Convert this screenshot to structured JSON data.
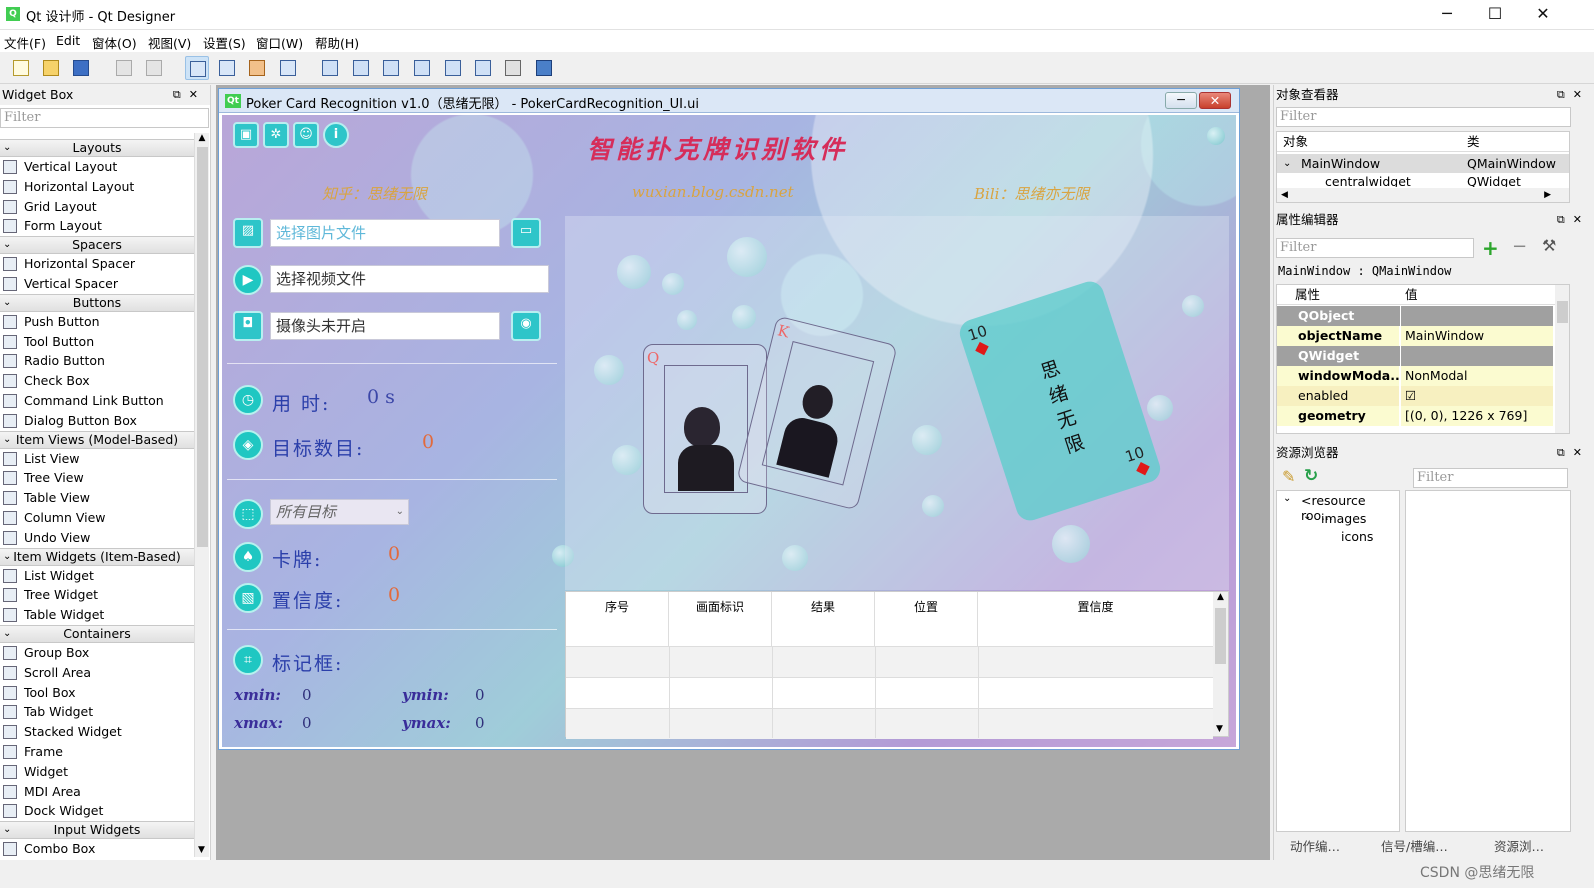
{
  "window": {
    "title": "Qt 设计师 - Qt Designer",
    "app_icon": "qt-icon"
  },
  "menu": [
    "文件(F)",
    "Edit",
    "窗体(O)",
    "视图(V)",
    "设置(S)",
    "窗口(W)",
    "帮助(H)"
  ],
  "widget_box": {
    "title": "Widget Box",
    "filter_placeholder": "Filter",
    "categories": [
      {
        "name": "Layouts",
        "items": [
          "Vertical Layout",
          "Horizontal Layout",
          "Grid Layout",
          "Form Layout"
        ]
      },
      {
        "name": "Spacers",
        "items": [
          "Horizontal Spacer",
          "Vertical Spacer"
        ]
      },
      {
        "name": "Buttons",
        "items": [
          "Push Button",
          "Tool Button",
          "Radio Button",
          "Check Box",
          "Command Link Button",
          "Dialog Button Box"
        ]
      },
      {
        "name": "Item Views (Model-Based)",
        "items": [
          "List View",
          "Tree View",
          "Table View",
          "Column View",
          "Undo View"
        ]
      },
      {
        "name": "Item Widgets (Item-Based)",
        "items": [
          "List Widget",
          "Tree Widget",
          "Table Widget"
        ]
      },
      {
        "name": "Containers",
        "items": [
          "Group Box",
          "Scroll Area",
          "Tool Box",
          "Tab Widget",
          "Stacked Widget",
          "Frame",
          "Widget",
          "MDI Area",
          "Dock Widget"
        ]
      },
      {
        "name": "Input Widgets",
        "items": [
          "Combo Box"
        ]
      }
    ]
  },
  "form": {
    "title": "Poker Card Recognition v1.0（思绪无限） - PokerCardRecognition_UI.ui",
    "heading": "智能扑克牌识别软件",
    "credit_left": "知乎：思绪无限",
    "credit_mid": "wuxian.blog.csdn.net",
    "credit_right": "Bili：思绪亦无限",
    "image_input": "选择图片文件",
    "video_input": "选择视频文件",
    "camera_input": "摄像头未开启",
    "time_label": "用 时:",
    "time_value": "0 s",
    "count_label": "目标数目:",
    "count_value": "0",
    "target_select": "所有目标",
    "card_label": "卡牌:",
    "card_value": "0",
    "conf_label": "置信度:",
    "conf_value": "0",
    "box_label": "标记框:",
    "xmin_label": "xmin:",
    "xmin_value": "0",
    "ymin_label": "ymin:",
    "ymin_value": "0",
    "xmax_label": "xmax:",
    "xmax_value": "0",
    "ymax_label": "ymax:",
    "ymax_value": "0",
    "card_rank_q": "Q",
    "card_rank_k": "K",
    "card_rank_10": "10",
    "card_text": "思绪无限",
    "table_headers": [
      "序号",
      "画面标识",
      "结果",
      "位置",
      "置信度"
    ],
    "accent": "#1fc7c2",
    "heading_color": "#d62d5a"
  },
  "object_inspector": {
    "title": "对象查看器",
    "filter_placeholder": "Filter",
    "col_object": "对象",
    "col_class": "类",
    "rows": [
      {
        "object": "MainWindow",
        "class": "QMainWindow"
      },
      {
        "object": "centralwidget",
        "class": "QWidget"
      }
    ]
  },
  "property_editor": {
    "title": "属性编辑器",
    "filter_placeholder": "Filter",
    "context": "MainWindow : QMainWindow",
    "col_prop": "属性",
    "col_value": "值",
    "rows": [
      {
        "k": "QObject",
        "v": "",
        "type": "group"
      },
      {
        "k": "objectName",
        "v": "MainWindow",
        "type": "bold"
      },
      {
        "k": "QWidget",
        "v": "",
        "type": "group"
      },
      {
        "k": "windowModa...",
        "v": "NonModal",
        "type": "bold"
      },
      {
        "k": "enabled",
        "v": "☑",
        "type": "plain"
      },
      {
        "k": "geometry",
        "v": "[(0, 0), 1226 x 769]",
        "type": "bold"
      }
    ]
  },
  "resource_browser": {
    "title": "资源浏览器",
    "filter_placeholder": "Filter",
    "tree": [
      "<resource roo...",
      "images",
      "icons"
    ]
  },
  "bottom_tabs": [
    "动作编…",
    "信号/槽编…",
    "资源浏…"
  ],
  "watermark": "CSDN @思绪无限"
}
